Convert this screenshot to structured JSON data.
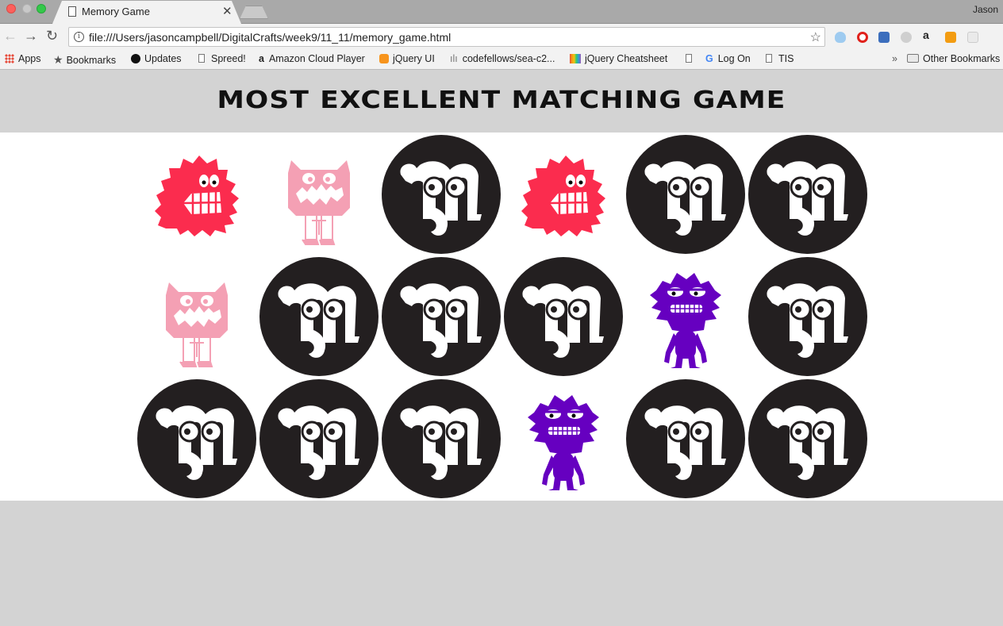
{
  "browser": {
    "tab_title": "Memory Game",
    "user_name": "Jason",
    "url": "file:///Users/jasoncampbell/DigitalCrafts/week9/11_11/memory_game.html",
    "bookmarks": [
      {
        "label": "Apps",
        "icon": "apps-icon"
      },
      {
        "label": "Bookmarks",
        "icon": "star-icon"
      },
      {
        "label": "Updates",
        "icon": "updates-icon"
      },
      {
        "label": "Spreed!",
        "icon": "document-icon"
      },
      {
        "label": "Amazon Cloud Player",
        "icon": "amazon-icon"
      },
      {
        "label": "jQuery UI",
        "icon": "jquery-ui-icon"
      },
      {
        "label": "codefellows/sea-c2...",
        "icon": "github-icon"
      },
      {
        "label": "jQuery Cheatsheet",
        "icon": "cheatsheet-icon"
      },
      {
        "label": "",
        "icon": "document-icon"
      },
      {
        "label": "Log On",
        "icon": "google-icon"
      },
      {
        "label": "TIS",
        "icon": "document-icon"
      }
    ],
    "more_bookmarks": "»",
    "other_bookmarks": "Other Bookmarks"
  },
  "page": {
    "title": "MOST EXCELLENT MATCHING GAME"
  },
  "game": {
    "colors": {
      "card_back": "#231f20",
      "red_monster": "#fb2c4e",
      "pink_monster": "#f4a0b4",
      "purple_monster": "#6600c0"
    },
    "cards": [
      {
        "face": "red-monster",
        "state": "revealed"
      },
      {
        "face": "pink-monster",
        "state": "revealed"
      },
      {
        "face": "m-logo",
        "state": "hidden"
      },
      {
        "face": "red-monster",
        "state": "revealed"
      },
      {
        "face": "m-logo",
        "state": "hidden"
      },
      {
        "face": "m-logo",
        "state": "hidden"
      },
      {
        "face": "pink-monster",
        "state": "revealed"
      },
      {
        "face": "m-logo",
        "state": "hidden"
      },
      {
        "face": "m-logo",
        "state": "hidden"
      },
      {
        "face": "m-logo",
        "state": "hidden"
      },
      {
        "face": "purple-monster",
        "state": "revealed"
      },
      {
        "face": "m-logo",
        "state": "hidden"
      },
      {
        "face": "m-logo",
        "state": "hidden"
      },
      {
        "face": "m-logo",
        "state": "hidden"
      },
      {
        "face": "m-logo",
        "state": "hidden"
      },
      {
        "face": "purple-monster",
        "state": "revealed"
      },
      {
        "face": "m-logo",
        "state": "hidden"
      },
      {
        "face": "m-logo",
        "state": "hidden"
      }
    ]
  }
}
